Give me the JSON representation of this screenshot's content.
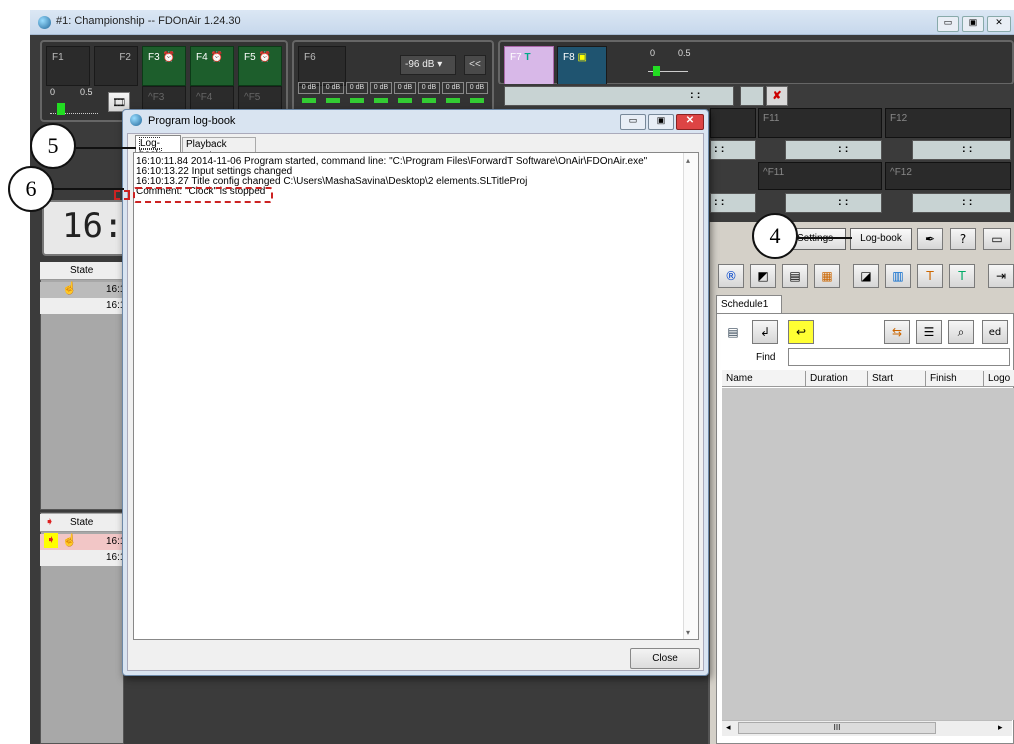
{
  "window": {
    "title": "#1: Championship -- FDOnAir 1.24.30"
  },
  "fkeys": {
    "f1": "F1",
    "f2": "F2",
    "f3": "F3",
    "f4": "F4",
    "f5": "F5",
    "f6": "F6",
    "f7": "F7",
    "f8": "F8",
    "sf3": "^F3",
    "sf4": "^F4",
    "sf5": "^F5",
    "f11": "F11",
    "f12": "F12",
    "sf11": "^F11",
    "sf12": "^F12"
  },
  "audio": {
    "slider_min": "0",
    "slider_max": "0.5",
    "db_select": "-96 dB",
    "rewind": "<<",
    "meters": [
      "0 dB",
      "0 dB",
      "0 dB",
      "0 dB",
      "0 dB",
      "0 dB",
      "0 dB",
      "0 dB"
    ]
  },
  "timer_colon": ": :",
  "clock": "16:",
  "left_table": {
    "header": "State",
    "rows": [
      "16:1",
      "16:1"
    ],
    "rows2": [
      "16:1",
      "16:1"
    ]
  },
  "right_panel": {
    "settings_btn": "Settings",
    "logbook_btn": "Log-book",
    "schedule_tab": "Schedule1",
    "find_label": "Find",
    "find_value": "",
    "columns": [
      "Name",
      "Duration",
      "Start",
      "Finish",
      "Logo"
    ],
    "scroll_thumb": "III"
  },
  "dialog": {
    "title": "Program log-book",
    "tabs": [
      "Log-book",
      "Playback report"
    ],
    "lines": [
      "16:10:11.84  2014-11-06 Program started, command line: \"C:\\Program Files\\ForwardT Software\\OnAir\\FDOnAir.exe\"",
      "16:10:13.22  Input settings changed",
      "16:10:13.27  Title config changed C:\\Users\\MashaSavina\\Desktop\\2 elements.SLTitleProj",
      "Comment: \"Clock\" is stopped"
    ],
    "close_btn": "Close"
  },
  "callouts": {
    "c4": "4",
    "c5": "5",
    "c6": "6"
  }
}
